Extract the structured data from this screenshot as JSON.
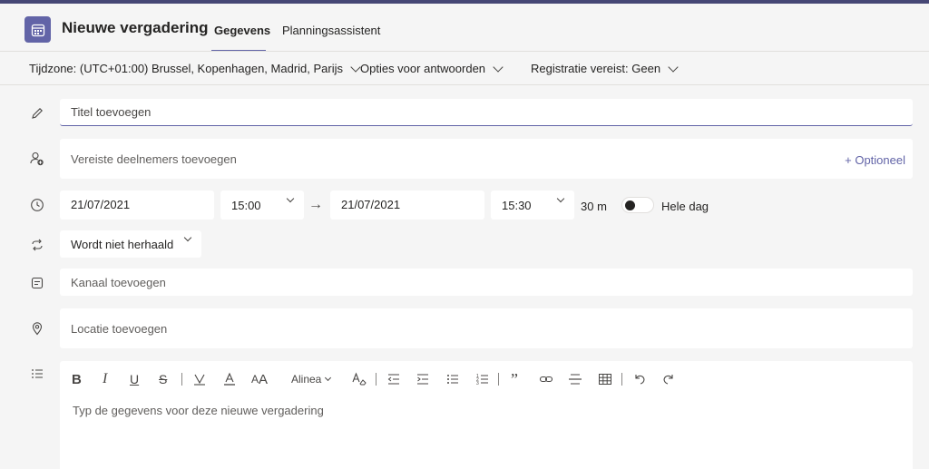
{
  "header": {
    "title": "Nieuwe vergadering",
    "tabs": [
      {
        "label": "Gegevens",
        "active": true
      },
      {
        "label": "Planningsassistent",
        "active": false
      }
    ]
  },
  "options": {
    "timezone": "Tijdzone: (UTC+01:00) Brussel, Kopenhagen, Madrid, Parijs",
    "response_options": "Opties voor antwoorden",
    "registration": "Registratie vereist: Geen"
  },
  "form": {
    "title_placeholder": "Titel toevoegen",
    "attendees_placeholder": "Vereiste deelnemers toevoegen",
    "optional_label": "+ Optioneel",
    "start_date": "21/07/2021",
    "start_time": "15:00",
    "end_date": "21/07/2021",
    "end_time": "15:30",
    "duration": "30 m",
    "all_day_label": "Hele dag",
    "all_day_on": false,
    "repeat": "Wordt niet herhaald",
    "channel_placeholder": "Kanaal toevoegen",
    "location_placeholder": "Locatie toevoegen"
  },
  "editor": {
    "paragraph_label": "Alinea",
    "placeholder": "Typ de gegevens voor deze nieuwe vergadering"
  },
  "colors": {
    "accent": "#6264a7",
    "top_stripe": "#464775"
  }
}
